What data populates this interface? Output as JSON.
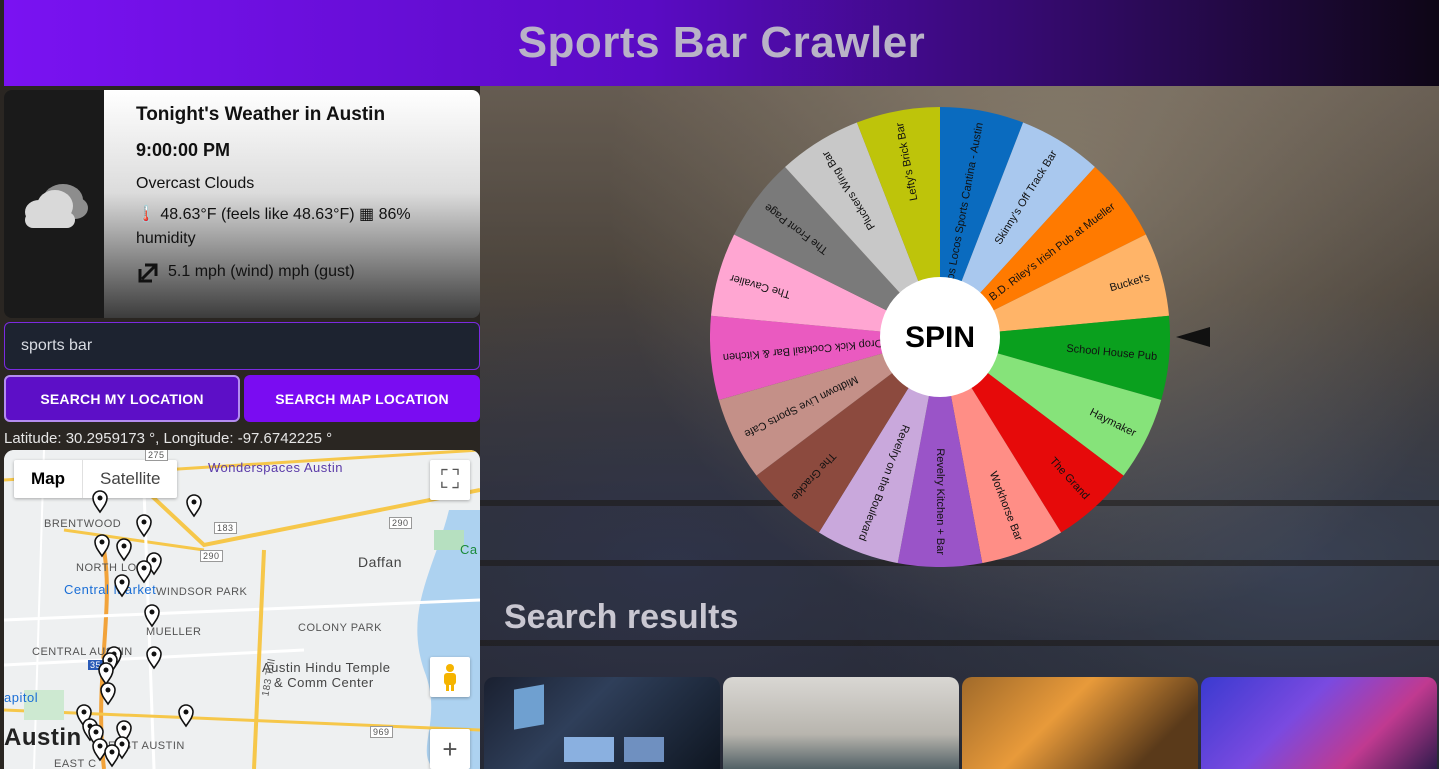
{
  "app": {
    "title": "Sports Bar Crawler"
  },
  "weather": {
    "title": "Tonight's Weather in Austin",
    "time": "9:00:00 PM",
    "description": "Overcast Clouds",
    "temp_line": "🌡️ 48.63°F (feels like 48.63°F) ▦ 86% humidity",
    "wind_line": "5.1 mph (wind) mph (gust)",
    "icon": "cloud-icon"
  },
  "search": {
    "value": "sports bar",
    "my_location_label": "SEARCH MY LOCATION",
    "map_location_label": "SEARCH MAP LOCATION",
    "coords": "Latitude: 30.2959173 °, Longitude: -97.6742225 °"
  },
  "map": {
    "tab_map": "Map",
    "tab_satellite": "Satellite",
    "labels": {
      "wonderspaces": "Wonderspaces Austin",
      "brentwood": "BRENTWOOD",
      "north_loop": "NORTH LOOP",
      "central_market": "Central Market",
      "windsor_park": "WINDSOR PARK",
      "daffan": "Daffan",
      "mueller": "MUELLER",
      "colony_park": "COLONY PARK",
      "central_austin": "CENTRAL AUSTIN",
      "hindu_temple": "Austin Hindu Temple",
      "comm_center": "& Comm Center",
      "austin": "Austin",
      "east_austin": "EAST AUSTIN",
      "east_c": "EAST C",
      "capitol": "apitol",
      "cap": "Ca",
      "toll": "183 Toll",
      "r275": "275",
      "r183": "183",
      "r290a": "290",
      "r290b": "290",
      "r35": "35",
      "r969": "969"
    }
  },
  "wheel": {
    "center_label": "SPIN",
    "segments": [
      {
        "label": "Los Locos Sports Cantina - Austin",
        "color": "#0a6bbf"
      },
      {
        "label": "Skinny's Off Track Bar",
        "color": "#a9c8ee"
      },
      {
        "label": "B.D. Riley's Irish Pub at Mueller",
        "color": "#ff7a00"
      },
      {
        "label": "Bucket's",
        "color": "#ffb468"
      },
      {
        "label": "School House Pub",
        "color": "#0aa01e"
      },
      {
        "label": "Haymaker",
        "color": "#86e37a"
      },
      {
        "label": "The Grand",
        "color": "#e60a0a"
      },
      {
        "label": "Workhorse Bar",
        "color": "#ff8e86"
      },
      {
        "label": "Revelry Kitchen + Bar",
        "color": "#9a54c8"
      },
      {
        "label": "Revelry on the Boulevard",
        "color": "#c9a8dc"
      },
      {
        "label": "The Grackle",
        "color": "#8c4a3e"
      },
      {
        "label": "Midtown Live Sports Cafe",
        "color": "#c49088"
      },
      {
        "label": "Drop Kick Cocktail Bar & Kitchen",
        "color": "#ea5ac0"
      },
      {
        "label": "The Cavalier",
        "color": "#ffa6d2"
      },
      {
        "label": "The Front Page",
        "color": "#7a7a7a"
      },
      {
        "label": "Pluckers Wing Bar",
        "color": "#c8c8c8"
      },
      {
        "label": "Lefty's Brick Bar",
        "color": "#bec40a"
      }
    ]
  },
  "results": {
    "title": "Search results"
  }
}
